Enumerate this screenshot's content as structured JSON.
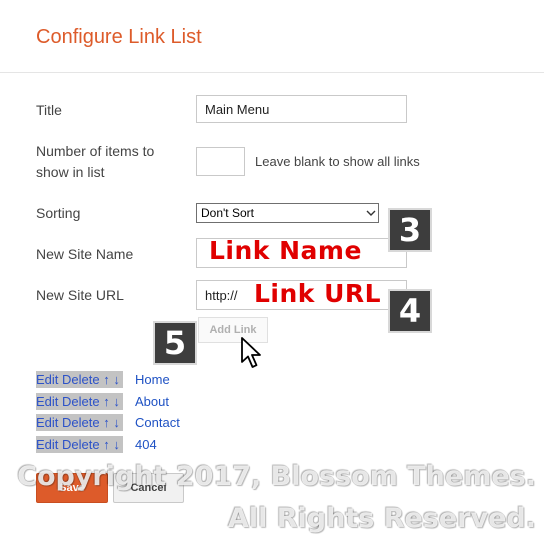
{
  "dialog": {
    "title": "Configure Link List"
  },
  "form": {
    "title_label": "Title",
    "title_value": "Main Menu",
    "items_label_line1": "Number of items to",
    "items_label_line2": "show in list",
    "items_value": "",
    "items_hint": "Leave blank to show all links",
    "sorting_label": "Sorting",
    "sorting_value": "Don't Sort",
    "site_name_label": "New Site Name",
    "site_url_label": "New Site URL",
    "site_url_value": "http://",
    "add_link_label": "Add Link"
  },
  "annotations": {
    "link_name": "Link Name",
    "link_url": "Link URL",
    "step3": "3",
    "step4": "4",
    "step5": "5"
  },
  "links": [
    {
      "edit": "Edit",
      "delete": "Delete",
      "up": "↑",
      "down": "↓",
      "name": "Home"
    },
    {
      "edit": "Edit",
      "delete": "Delete",
      "up": "↑",
      "down": "↓",
      "name": "About"
    },
    {
      "edit": "Edit",
      "delete": "Delete",
      "up": "↑",
      "down": "↓",
      "name": "Contact"
    },
    {
      "edit": "Edit",
      "delete": "Delete",
      "up": "↑",
      "down": "↓",
      "name": "404"
    }
  ],
  "buttons": {
    "save": "Save",
    "cancel": "Cancel"
  },
  "watermark": {
    "line1": "Copyright 2017, Blossom Themes.",
    "line2": "All Rights Reserved."
  },
  "colors": {
    "accent": "#dd5b2a",
    "annotation_red": "#e00000",
    "link_blue": "#1f52c4"
  }
}
